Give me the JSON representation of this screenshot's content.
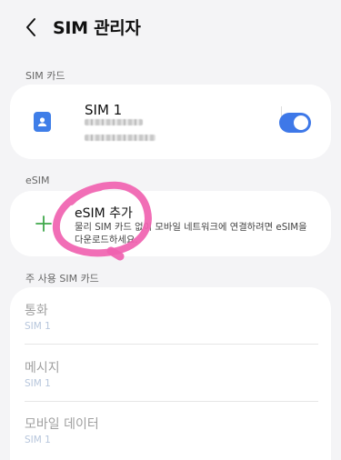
{
  "header": {
    "title": "SIM 관리자",
    "back_icon": "chevron-left-icon"
  },
  "sections": {
    "sim_cards": "SIM 카드",
    "esim": "eSIM",
    "primary": "주 사용 SIM 카드"
  },
  "sim": {
    "name": "SIM 1",
    "enabled": true,
    "accent_color": "#3e78e8",
    "icon": "sim-contact-icon"
  },
  "esim_add": {
    "title": "eSIM 추가",
    "description": "물리 SIM 카드 없이 모바일 네트워크에 연결하려면 eSIM을 다운로드하세요.",
    "icon": "plus-icon",
    "annotation_color": "#f062b0"
  },
  "primary_sim": [
    {
      "title": "통화",
      "value": "SIM 1"
    },
    {
      "title": "메시지",
      "value": "SIM 1"
    },
    {
      "title": "모바일 데이터",
      "value": "SIM 1"
    }
  ]
}
